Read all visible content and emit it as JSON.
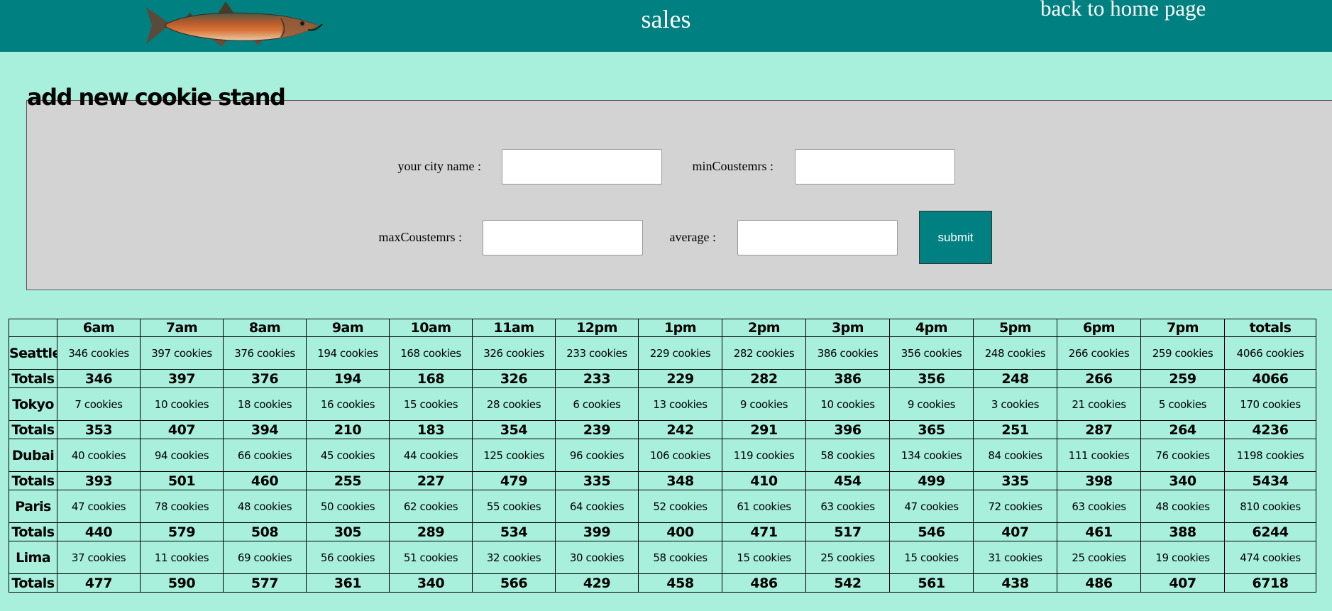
{
  "header": {
    "title": "sales",
    "home_link": "back to home page",
    "colors": {
      "header_bg": "#008080",
      "page_bg": "#a8f0dc",
      "text": "#ffffff"
    },
    "logo_icon": "salmon-fish-logo"
  },
  "form": {
    "legend": "add new cookie stand",
    "city_label": "your city name :",
    "min_label": "minCoustemrs :",
    "max_label": "maxCoustemrs :",
    "avg_label": "average :",
    "city_value": "",
    "min_value": "",
    "max_value": "",
    "avg_value": "",
    "submit_label": "submit",
    "colors": {
      "panel_bg": "#d3d3d3",
      "button_bg": "#008080"
    }
  },
  "table": {
    "hours": [
      "6am",
      "7am",
      "8am",
      "9am",
      "10am",
      "11am",
      "12pm",
      "1pm",
      "2pm",
      "3pm",
      "4pm",
      "5pm",
      "6pm",
      "7pm",
      "totals"
    ],
    "totals_label": "Totals",
    "rows": [
      {
        "city": "Seattle",
        "cells": [
          "346 cookies",
          "397 cookies",
          "376 cookies",
          "194 cookies",
          "168 cookies",
          "326 cookies",
          "233 cookies",
          "229 cookies",
          "282 cookies",
          "386 cookies",
          "356 cookies",
          "248 cookies",
          "266 cookies",
          "259 cookies",
          "4066 cookies"
        ],
        "totals": [
          "346",
          "397",
          "376",
          "194",
          "168",
          "326",
          "233",
          "229",
          "282",
          "386",
          "356",
          "248",
          "266",
          "259",
          "4066"
        ]
      },
      {
        "city": "Tokyo",
        "cells": [
          "7 cookies",
          "10 cookies",
          "18 cookies",
          "16 cookies",
          "15 cookies",
          "28 cookies",
          "6 cookies",
          "13 cookies",
          "9 cookies",
          "10 cookies",
          "9 cookies",
          "3 cookies",
          "21 cookies",
          "5 cookies",
          "170 cookies"
        ],
        "totals": [
          "353",
          "407",
          "394",
          "210",
          "183",
          "354",
          "239",
          "242",
          "291",
          "396",
          "365",
          "251",
          "287",
          "264",
          "4236"
        ]
      },
      {
        "city": "Dubai",
        "cells": [
          "40 cookies",
          "94 cookies",
          "66 cookies",
          "45 cookies",
          "44 cookies",
          "125 cookies",
          "96 cookies",
          "106 cookies",
          "119 cookies",
          "58 cookies",
          "134 cookies",
          "84 cookies",
          "111 cookies",
          "76 cookies",
          "1198 cookies"
        ],
        "totals": [
          "393",
          "501",
          "460",
          "255",
          "227",
          "479",
          "335",
          "348",
          "410",
          "454",
          "499",
          "335",
          "398",
          "340",
          "5434"
        ]
      },
      {
        "city": "Paris",
        "cells": [
          "47 cookies",
          "78 cookies",
          "48 cookies",
          "50 cookies",
          "62 cookies",
          "55 cookies",
          "64 cookies",
          "52 cookies",
          "61 cookies",
          "63 cookies",
          "47 cookies",
          "72 cookies",
          "63 cookies",
          "48 cookies",
          "810 cookies"
        ],
        "totals": [
          "440",
          "579",
          "508",
          "305",
          "289",
          "534",
          "399",
          "400",
          "471",
          "517",
          "546",
          "407",
          "461",
          "388",
          "6244"
        ]
      },
      {
        "city": "Lima",
        "cells": [
          "37 cookies",
          "11 cookies",
          "69 cookies",
          "56 cookies",
          "51 cookies",
          "32 cookies",
          "30 cookies",
          "58 cookies",
          "15 cookies",
          "25 cookies",
          "15 cookies",
          "31 cookies",
          "25 cookies",
          "19 cookies",
          "474 cookies"
        ],
        "totals": [
          "477",
          "590",
          "577",
          "361",
          "340",
          "566",
          "429",
          "458",
          "486",
          "542",
          "561",
          "438",
          "486",
          "407",
          "6718"
        ]
      }
    ]
  }
}
